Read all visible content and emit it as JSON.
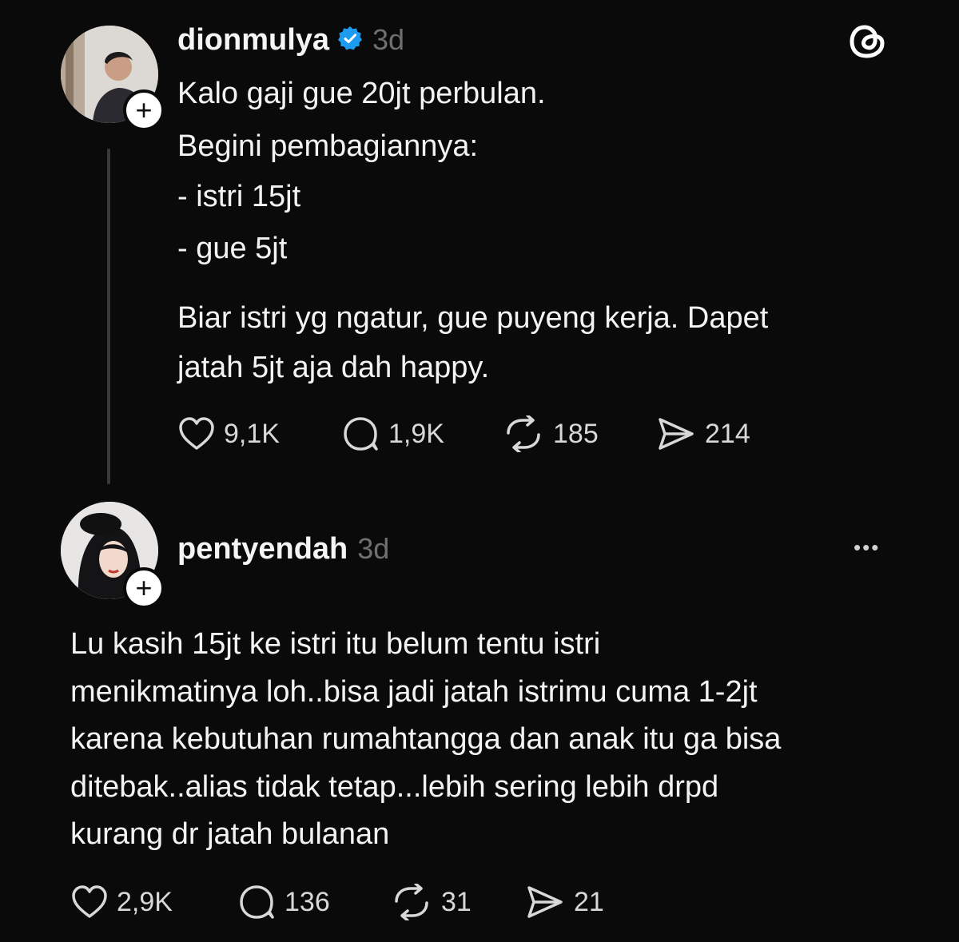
{
  "post1": {
    "username": "dionmulya",
    "time": "3d",
    "lines": [
      "Kalo gaji gue 20jt perbulan.",
      "Begini pembagiannya:",
      "- istri 15jt",
      "- gue 5jt",
      "Biar istri yg ngatur, gue puyeng kerja. Dapet",
      "jatah 5jt aja dah happy."
    ],
    "stats": {
      "likes": "9,1K",
      "replies": "1,9K",
      "reposts": "185",
      "shares": "214"
    }
  },
  "post2": {
    "username": "pentyendah",
    "time": "3d",
    "lines": [
      "Lu kasih 15jt ke istri itu belum tentu istri",
      "menikmatinya loh..bisa jadi jatah istrimu cuma 1-2jt",
      "karena kebutuhan rumahtangga dan anak itu ga bisa",
      "ditebak..alias tidak tetap...lebih sering lebih drpd",
      "kurang dr jatah bulanan"
    ],
    "stats": {
      "likes": "2,9K",
      "replies": "136",
      "reposts": "31",
      "shares": "21"
    }
  },
  "icons": {
    "follow": "+",
    "more": "•••"
  },
  "colors": {
    "background": "#0a0a0a",
    "verified": "#1d9bf0",
    "muted": "#6f6f6f"
  }
}
